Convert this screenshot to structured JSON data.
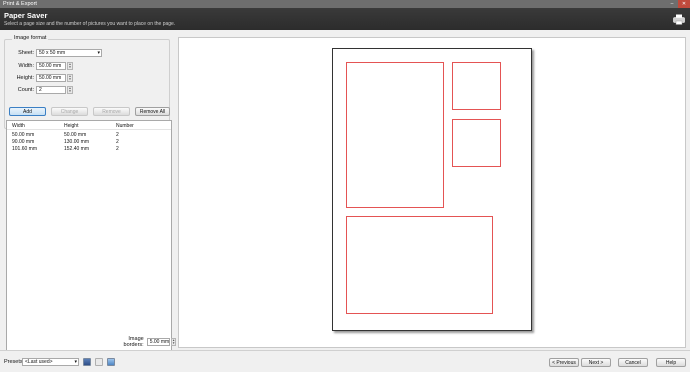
{
  "window": {
    "title": "Print & Export",
    "minimize": "–",
    "close": "✕"
  },
  "header": {
    "title": "Paper Saver",
    "subtitle": "Select a page size and the number of pictures you want to place on the page."
  },
  "image_format": {
    "group_title": "Image format",
    "sheet_label": "Sheet:",
    "sheet_value": "50 x 50 mm",
    "width_label": "Width:",
    "width_value": "50.00 mm",
    "height_label": "Height:",
    "height_value": "50.00 mm",
    "count_label": "Count:",
    "count_value": "2"
  },
  "buttons": {
    "add": "Add",
    "change": "Change",
    "remove": "Remove",
    "remove_all": "Remove All"
  },
  "list": {
    "columns": [
      "Width",
      "Height",
      "Number"
    ],
    "rows": [
      [
        "50.00 mm",
        "50.00 mm",
        "2"
      ],
      [
        "90.00 mm",
        "130.00 mm",
        "2"
      ],
      [
        "101.60 mm",
        "152.40 mm",
        "2"
      ]
    ]
  },
  "image_borders": {
    "label": "Image borders:",
    "value": "5.00 mm"
  },
  "footer": {
    "presets_label": "Presets:",
    "presets_value": "<Last used>",
    "previous": "< Previous",
    "next": "Next >",
    "cancel": "Cancel",
    "help": "Help"
  },
  "colors": {
    "accent": "#3b7fc4",
    "picture_outline": "#e45454",
    "header_bg": "#2c2c2c"
  }
}
